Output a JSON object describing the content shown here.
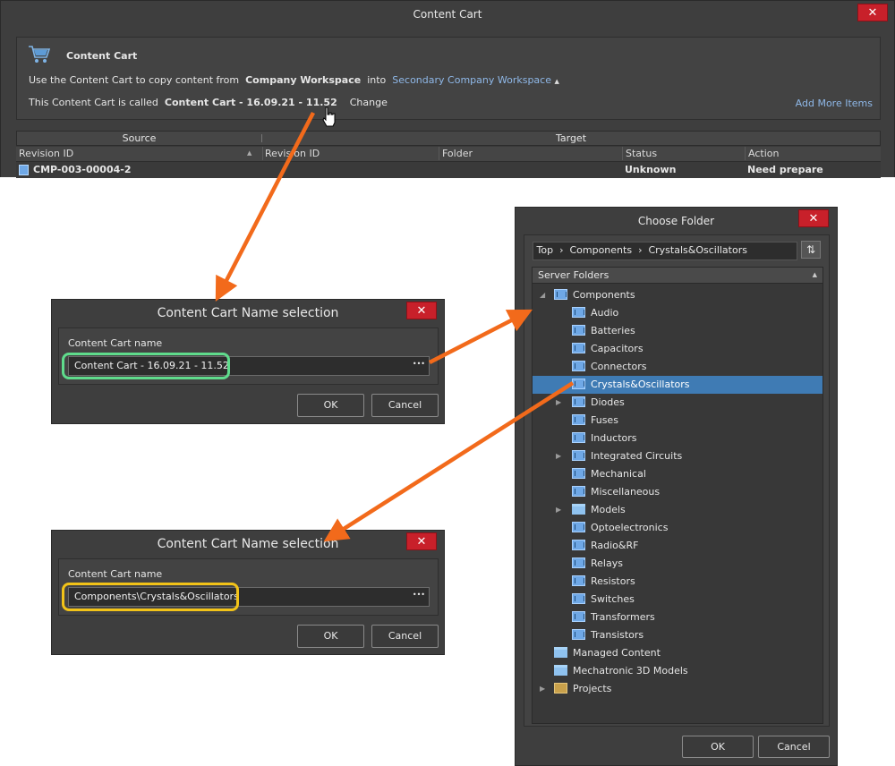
{
  "content_cart": {
    "title": "Content Cart",
    "close": "✕",
    "heading": "Content Cart",
    "line1_pre": "Use the Content Cart to copy content from",
    "source_workspace": "Company Workspace",
    "line1_into": "into",
    "target_workspace": "Secondary Company Workspace",
    "line2_pre": "This Content Cart is called",
    "cart_name": "Content Cart - 16.09.21 - 11.52",
    "change_link": "Change",
    "add_more": "Add More Items",
    "group_source": "Source",
    "group_target": "Target",
    "columns": [
      "Revision ID",
      "Revision ID",
      "Folder",
      "Status",
      "Action"
    ],
    "row": {
      "revision_id": "CMP-003-00004-2",
      "status": "Unknown",
      "action": "Need prepare"
    }
  },
  "name_dialog_1": {
    "title": "Content Cart Name selection",
    "close": "✕",
    "label": "Content Cart name",
    "value": "Content Cart - 16.09.21 - 11.52",
    "browse": "•••",
    "ok": "OK",
    "cancel": "Cancel"
  },
  "name_dialog_2": {
    "title": "Content Cart Name selection",
    "close": "✕",
    "label": "Content Cart name",
    "value": "Components\\Crystals&Oscillators",
    "browse": "•••",
    "ok": "OK",
    "cancel": "Cancel"
  },
  "choose_folder": {
    "title": "Choose Folder",
    "close": "✕",
    "breadcrumb": [
      "Top",
      "Components",
      "Crystals&Oscillators"
    ],
    "breadcrumb_sep": "›",
    "tree_header": "Server Folders",
    "root": "Components",
    "children": [
      {
        "label": "Audio"
      },
      {
        "label": "Batteries"
      },
      {
        "label": "Capacitors"
      },
      {
        "label": "Connectors"
      },
      {
        "label": "Crystals&Oscillators"
      },
      {
        "label": "Diodes"
      },
      {
        "label": "Fuses"
      },
      {
        "label": "Inductors"
      },
      {
        "label": "Integrated Circuits"
      },
      {
        "label": "Mechanical"
      },
      {
        "label": "Miscellaneous"
      },
      {
        "label": "Models"
      },
      {
        "label": "Optoelectronics"
      },
      {
        "label": "Radio&RF"
      },
      {
        "label": "Relays"
      },
      {
        "label": "Resistors"
      },
      {
        "label": "Switches"
      },
      {
        "label": "Transformers"
      },
      {
        "label": "Transistors"
      }
    ],
    "others": [
      "Managed Content",
      "Mechatronic 3D Models",
      "Projects"
    ],
    "ok": "OK",
    "cancel": "Cancel"
  },
  "colors": {
    "arrow": "#f26a1b",
    "highlight_green": "#5fdc8c",
    "highlight_yellow": "#f2c318",
    "selection": "#3f7bb4",
    "close_red": "#c8202a"
  }
}
